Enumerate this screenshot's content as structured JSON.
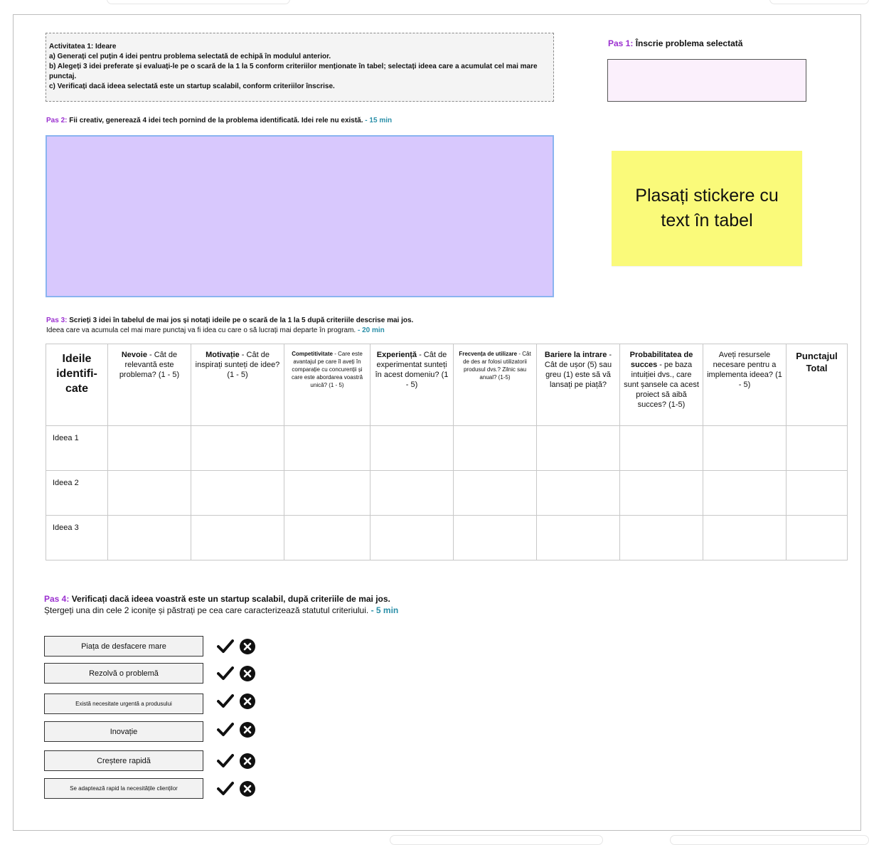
{
  "activity": {
    "lines": [
      "Activitatea 1: Ideare",
      "a) Generați cel puțin 4 idei pentru problema selectată de echipă în modulul anterior.",
      "b) Alegeți 3 idei preferate și evaluați-le pe o scară de la 1 la 5 conform criteriilor menționate în tabel; selectați ideea care a acumulat cel mai mare punctaj.",
      "c) Verificați dacă ideea selectată este un startup scalabil, conform criteriilor înscrise."
    ]
  },
  "pas1": {
    "label": "Pas 1:",
    "text": " Înscrie problema selectată"
  },
  "pas2": {
    "label": "Pas 2:",
    "text": " Fii creativ, generează 4 idei tech pornind de la problema identificată. Idei rele nu există.",
    "time": " - 15 min"
  },
  "sticky": {
    "text": "Plasați stickere cu text în tabel"
  },
  "pas3": {
    "label": "Pas 3:",
    "line1": " Scrieți 3 idei în tabelul de mai jos și notați ideile pe o scară de la 1 la 5 după criteriile descrise mai jos.",
    "line2": "Ideea care va acumula cel mai mare punctaj va fi idea cu care o să lucrați mai  departe în program.",
    "time": " - 20 min"
  },
  "table": {
    "headers": [
      {
        "bold": "Ideile identifi-cate",
        "rest": ""
      },
      {
        "bold": "Nevoie",
        "rest": " - Cât de relevantă este problema? (1 - 5)"
      },
      {
        "bold": "Motivație",
        "rest": " - Cât de inspirați sunteți de idee? (1 - 5)"
      },
      {
        "bold": "Competitivitate",
        "rest": " - Care este avantajul pe care îl aveți în comparație cu concurenții și care este abordarea voastră unică? (1 - 5)"
      },
      {
        "bold": "Experiență",
        "rest": " - Cât de experimentat sunteți în acest domeniu? (1 - 5)"
      },
      {
        "bold": "Frecvența de utilizare",
        "rest": " - Cât de des ar folosi utilizatorii produsul dvs.? Zilnic sau anual? (1-5)"
      },
      {
        "bold": "Bariere la intrare",
        "rest": " - Cât de ușor (5) sau greu (1) este să vă lansați pe piață?"
      },
      {
        "bold": "Probabilitatea de succes",
        "rest": " - pe baza intuiției dvs., care sunt șansele ca acest proiect să aibă succes? (1-5)"
      },
      {
        "bold": "Aveți resurse",
        "rest": "le necesare pentru a implementa ideea? (1 - 5)"
      },
      {
        "bold": "Punctajul Total",
        "rest": ""
      }
    ],
    "rows": [
      "Ideea 1",
      "Ideea 2",
      "Ideea 3"
    ]
  },
  "pas4": {
    "label": "Pas 4:",
    "line1": "  Verificați dacă ideea voastră este un startup scalabil, după criteriile de mai jos.",
    "line2": "Ștergeți una din cele 2 iconițe și păstrați pe cea care caracterizează statutul criteriului.",
    "time": "  - 5 min"
  },
  "criteria": [
    "Piața de desfacere mare",
    "Rezolvă o problemă",
    "Există necesitate urgentă a produsului",
    "Inovație",
    "Creștere rapidă",
    "Se adaptează rapid la necesitățile clienților"
  ],
  "icons": {
    "check": "checkmark-icon",
    "cross": "close-circle-icon"
  }
}
